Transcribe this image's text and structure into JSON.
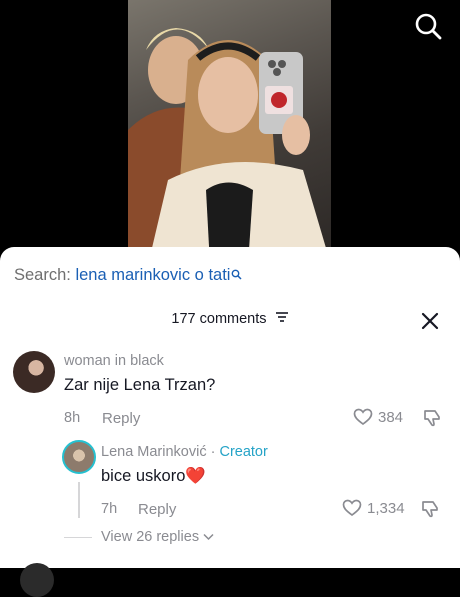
{
  "search": {
    "label": "Search:",
    "query": "lena marinkovic o tati"
  },
  "comments_header": {
    "count_label": "177 comments"
  },
  "comment": {
    "username": "woman in black",
    "text": "Zar nije Lena Trzan?",
    "time": "8h",
    "reply_label": "Reply",
    "likes": "384"
  },
  "reply": {
    "username": "Lena Marinković",
    "separator": " · ",
    "badge": "Creator",
    "text": "bice uskoro",
    "emoji": "❤️",
    "time": "7h",
    "reply_label": "Reply",
    "likes": "1,334"
  },
  "view_replies": {
    "label": "View 26 replies"
  },
  "colors": {
    "accent_search": "#1a5fb4",
    "creator_badge": "#25a3c7",
    "avatar_ring": "#25c0d0"
  },
  "icons": [
    "search-icon",
    "sort-icon",
    "close-icon",
    "heart-outline-icon",
    "dislike-icon",
    "chevron-down-icon"
  ]
}
